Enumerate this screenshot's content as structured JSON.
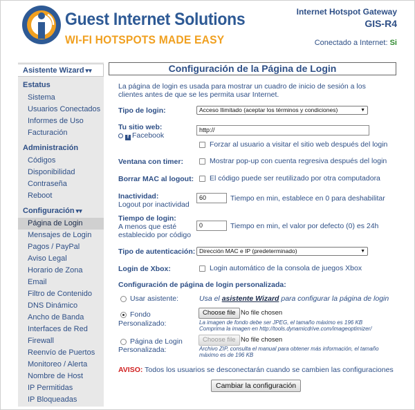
{
  "brand": {
    "name": "Guest Internet Solutions",
    "tagline": "WI-FI HOTSPOTS MADE EASY",
    "colors": {
      "blue": "#2e5a95",
      "orange": "#f0a020"
    }
  },
  "header": {
    "product": "Internet Hotspot Gateway",
    "model": "GIS-R4",
    "connection_label": "Conectado a Internet:",
    "connection_value": "Si"
  },
  "sidebar": {
    "wizard": "Asistente Wizard",
    "sections": [
      {
        "title": "Estatus",
        "items": [
          "Sistema",
          "Usuarios Conectados",
          "Informes de Uso",
          "Facturación"
        ]
      },
      {
        "title": "Administración",
        "items": [
          "Códigos",
          "Disponibilidad",
          "Contraseña",
          "Reboot"
        ]
      },
      {
        "title": "Configuración",
        "items": [
          "Página de Login",
          "Mensajes de Login",
          "Pagos / PayPal",
          "Aviso Legal",
          "Horario de Zona",
          "Email",
          "Filtro de Contenido",
          "DNS Dinámico",
          "Ancho de Banda",
          "Interfaces de Red",
          "Firewall",
          "Reenvío de Puertos",
          "Monitoreo / Alerta",
          "Nombre de Host",
          "IP Permitidas",
          "IP Bloqueadas"
        ]
      }
    ],
    "active_item": "Página de Login"
  },
  "main": {
    "title": "Configuración de la Página de Login",
    "intro": "La página de login es usada para mostrar un cuadro de inicio de sesión a los clientes antes de que se les permita usar Internet.",
    "login_type": {
      "label": "Tipo de login:",
      "value": "Acceso Ilimitado (aceptar los términos y condiciones)"
    },
    "website": {
      "label": "Tu sitio web:",
      "fb_label": "Facebook",
      "value": "http://",
      "force_label": "Forzar al usuario a visitar el sitio web después del login"
    },
    "timer": {
      "label": "Ventana con timer:",
      "check_label": "Mostrar pop-up con cuenta regresiva después del login"
    },
    "mac": {
      "label": "Borrar MAC al logout:",
      "check_label": "El código puede ser reutilizado por otra computadora"
    },
    "inactivity": {
      "label": "Inactividad:",
      "sub": "Logout por inactividad",
      "value": "60",
      "note": "Tiempo en min, establece en 0 para deshabilitar"
    },
    "login_time": {
      "label": "Tiempo de login:",
      "sub1": "A menos que esté",
      "sub2": "establecido por código",
      "value": "0",
      "note": "Tiempo en min, el valor por defecto (0) es 24h"
    },
    "auth_type": {
      "label": "Tipo de autenticación:",
      "value": "Dirección MAC e IP (predeterminado)"
    },
    "xbox": {
      "label": "Login de Xbox:",
      "check_label": "Login automático de la consola de juegos Xbox"
    },
    "custom": {
      "heading": "Configuración de página de login personalizada:",
      "wizard_option": "Usar asistente:",
      "wizard_text_pre": "Usa el",
      "wizard_link": "asistente Wizard",
      "wizard_text_post": "para configurar la página de login",
      "bg_option1": "Fondo",
      "bg_option2": "Personalizado:",
      "choose_file": "Choose file",
      "no_file": "No file chosen",
      "bg_hint1": "La imagen de fondo debe ser JPEG, el tamaño máximo es 196 KB",
      "bg_hint2": "Comprima la imagen en http://tools.dynamicdrive.com/imageoptimizer/",
      "page_option1": "Página de Login",
      "page_option2": "Personalizada:",
      "page_hint1": "Archivo ZIP, consulta el manual para obtener más información, el tamaño",
      "page_hint2": "máximo es de 196 KB"
    },
    "warning": {
      "key": "AVISO:",
      "text": "Todos los usuarios se desconectarán cuando se cambien las configuraciones"
    },
    "submit": "Cambiar la configuración"
  }
}
